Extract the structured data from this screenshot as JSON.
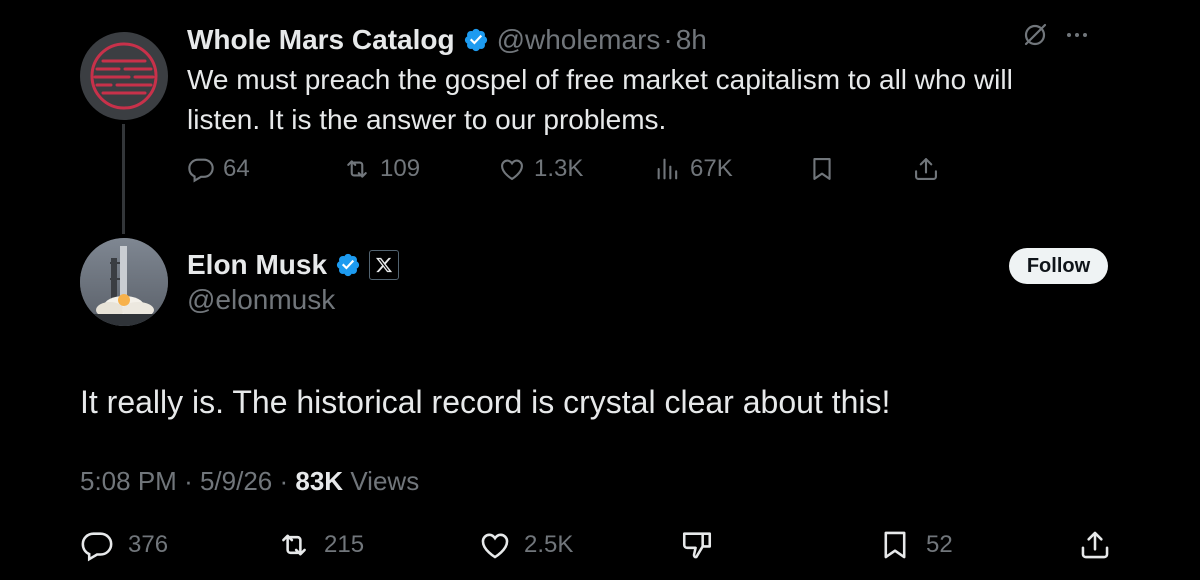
{
  "parent_tweet": {
    "display_name": "Whole Mars Catalog",
    "handle": "@wholemars",
    "time": "8h",
    "text": "We must preach the gospel of free market capitalism to all who will listen. It is the answer to our problems.",
    "stats": {
      "replies": "64",
      "reposts": "109",
      "likes": "1.3K",
      "views": "67K"
    }
  },
  "main_tweet": {
    "display_name": "Elon Musk",
    "handle": "@elonmusk",
    "follow_label": "Follow",
    "text": "It really is. The historical record is crystal clear about this!",
    "meta": {
      "time": "5:08 PM",
      "date": "5/9/26",
      "views_count": "83K",
      "views_label": "Views"
    },
    "stats": {
      "replies": "376",
      "reposts": "215",
      "likes": "2.5K",
      "bookmarks": "52"
    }
  },
  "colors": {
    "background": "#000000",
    "text": "#e7e9ea",
    "muted": "#71767b",
    "verified": "#1d9bf0",
    "follow_bg": "#eff3f4"
  }
}
